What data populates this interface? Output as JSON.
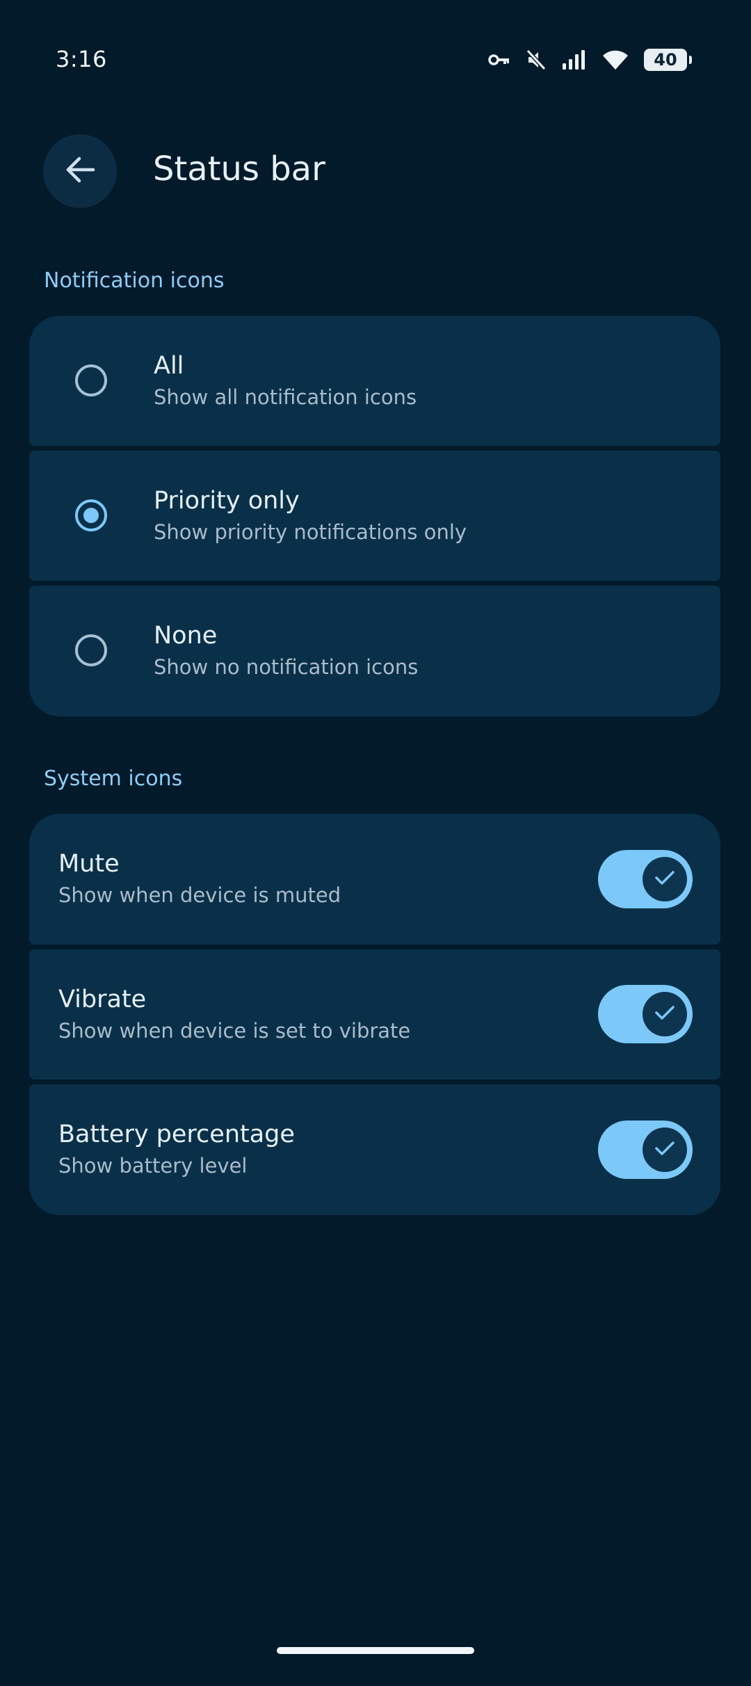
{
  "status_bar": {
    "time": "3:16",
    "battery": "40",
    "icons": [
      "vpn-key-icon",
      "mute-icon",
      "signal-icon",
      "wifi-icon",
      "battery-icon"
    ]
  },
  "header": {
    "back_icon": "arrow-back-icon",
    "title": "Status bar"
  },
  "notification_section": {
    "title": "Notification icons",
    "options": [
      {
        "label": "All",
        "description": "Show all notification icons",
        "selected": false
      },
      {
        "label": "Priority only",
        "description": "Show priority notifications only",
        "selected": true
      },
      {
        "label": "None",
        "description": "Show no notification icons",
        "selected": false
      }
    ]
  },
  "system_section": {
    "title": "System icons",
    "items": [
      {
        "label": "Mute",
        "description": "Show when device is muted",
        "enabled": true
      },
      {
        "label": "Vibrate",
        "description": "Show when device is set to vibrate",
        "enabled": true
      },
      {
        "label": "Battery percentage",
        "description": "Show battery level",
        "enabled": true
      }
    ]
  },
  "colors": {
    "background": "#031a2b",
    "card": "#0a3049",
    "accent": "#7cc8f8",
    "section_title": "#8fcdf6"
  }
}
